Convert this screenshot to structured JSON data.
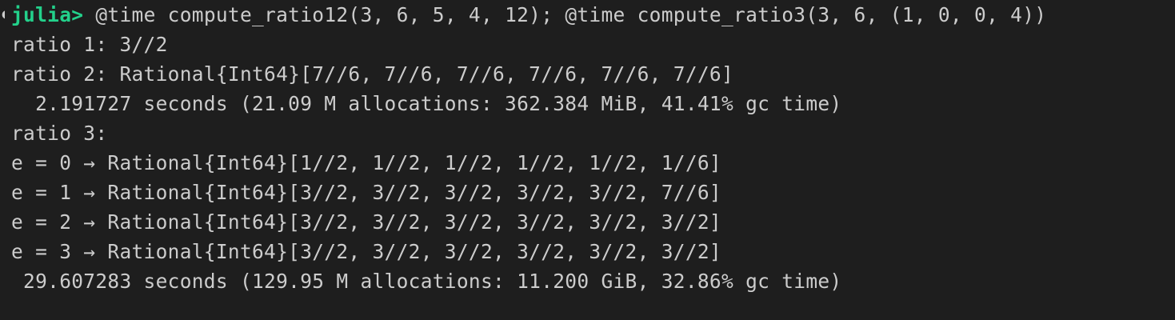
{
  "terminal": {
    "prompt": "julia>",
    "command": " @time compute_ratio12(3, 6, 5, 4, 12); @time compute_ratio3(3, 6, (1, 0, 0, 4))",
    "output": [
      "ratio 1: 3//2",
      "ratio 2: Rational{Int64}[7//6, 7//6, 7//6, 7//6, 7//6, 7//6]",
      "  2.191727 seconds (21.09 M allocations: 362.384 MiB, 41.41% gc time)",
      "ratio 3:",
      "e = 0 → Rational{Int64}[1//2, 1//2, 1//2, 1//2, 1//2, 1//6]",
      "e = 1 → Rational{Int64}[3//2, 3//2, 3//2, 3//2, 3//2, 7//6]",
      "e = 2 → Rational{Int64}[3//2, 3//2, 3//2, 3//2, 3//2, 3//2]",
      "e = 3 → Rational{Int64}[3//2, 3//2, 3//2, 3//2, 3//2, 3//2]",
      " 29.607283 seconds (129.95 M allocations: 11.200 GiB, 32.86% gc time)"
    ]
  },
  "colors": {
    "background": "#1e1e1e",
    "text": "#cccccc",
    "prompt": "#23d18b"
  }
}
